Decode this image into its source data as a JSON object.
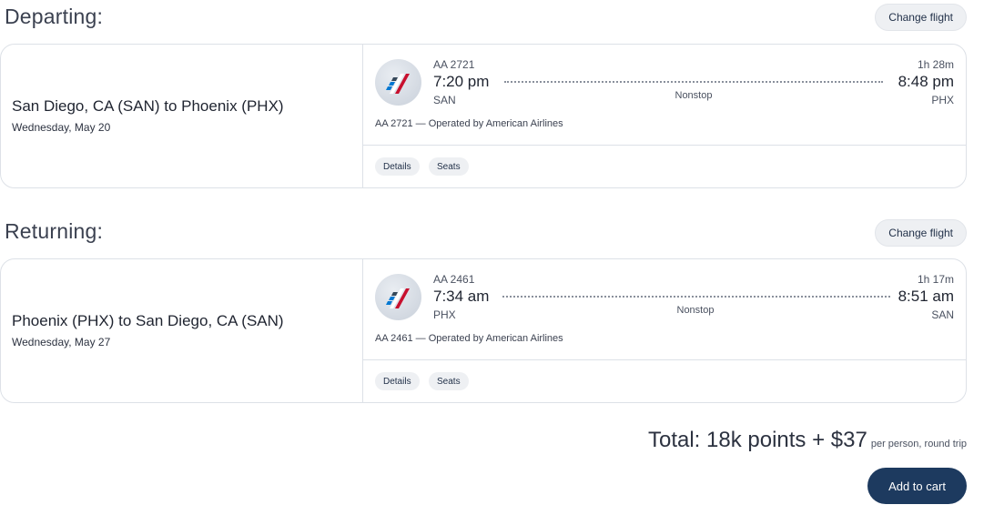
{
  "departing": {
    "title": "Departing:",
    "change_label": "Change flight",
    "route": "San Diego, CA (SAN) to Phoenix (PHX)",
    "date": "Wednesday, May 20",
    "flight_number": "AA 2721",
    "depart_time": "7:20 pm",
    "depart_code": "SAN",
    "duration": "1h 28m",
    "arrive_time": "8:48 pm",
    "arrive_code": "PHX",
    "stops": "Nonstop",
    "operated": "AA 2721 — Operated by American Airlines",
    "details_label": "Details",
    "seats_label": "Seats"
  },
  "returning": {
    "title": "Returning:",
    "change_label": "Change flight",
    "route": "Phoenix (PHX) to San Diego, CA (SAN)",
    "date": "Wednesday, May 27",
    "flight_number": "AA 2461",
    "depart_time": "7:34 am",
    "depart_code": "PHX",
    "duration": "1h 17m",
    "arrive_time": "8:51 am",
    "arrive_code": "SAN",
    "stops": "Nonstop",
    "operated": "AA 2461 — Operated by American Airlines",
    "details_label": "Details",
    "seats_label": "Seats"
  },
  "total": {
    "main": "Total: 18k points + $37",
    "sub": "per person, round trip"
  },
  "add_to_cart_label": "Add to cart",
  "icons": {
    "airline_logo": "american-airlines-logo-icon"
  },
  "colors": {
    "primary_button": "#1d3a5f",
    "pill_bg": "#eef0f3",
    "border": "#dde1e7"
  }
}
